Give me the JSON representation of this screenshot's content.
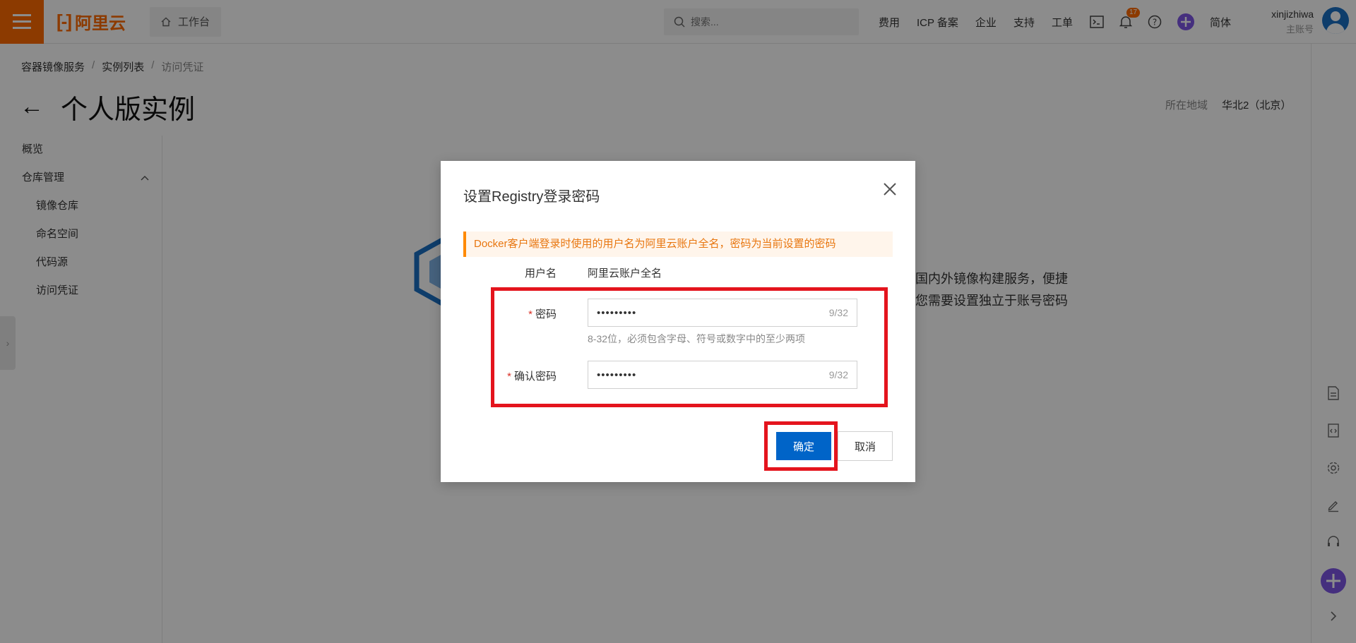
{
  "topbar": {
    "logo_text": "阿里云",
    "workbench_label": "工作台",
    "search_placeholder": "搜索...",
    "nav_links": [
      "费用",
      "ICP 备案",
      "企业",
      "支持",
      "工单"
    ],
    "notification_count": "17",
    "language": "简体",
    "username": "xinjizhiwa",
    "account_type": "主账号"
  },
  "breadcrumb": {
    "items": [
      "容器镜像服务",
      "实例列表",
      "访问凭证"
    ]
  },
  "page": {
    "title": "个人版实例",
    "region_label": "所在地域",
    "region_value": "华北2（北京）"
  },
  "sidebar": {
    "overview": "概览",
    "repo_group": "仓库管理",
    "sub_items": [
      "镜像仓库",
      "命名空间",
      "代码源",
      "访问凭证"
    ]
  },
  "background": {
    "line1": "国内外镜像构建服务，便捷",
    "line2": "您需要设置独立于账号密码"
  },
  "dialog": {
    "title": "设置Registry登录密码",
    "alert": "Docker客户端登录时使用的用户名为阿里云账户全名，密码为当前设置的密码",
    "username_label": "用户名",
    "username_value": "阿里云账户全名",
    "password_label": "密码",
    "password_value": "•••••••••",
    "password_count": "9/32",
    "password_hint": "8-32位，必须包含字母、符号或数字中的至少两项",
    "confirm_label": "确认密码",
    "confirm_value": "•••••••••",
    "confirm_count": "9/32",
    "ok_label": "确定",
    "cancel_label": "取消"
  },
  "colors": {
    "brand": "#ff6a00",
    "primary": "#0064c8",
    "highlight": "#e4141d",
    "alert_text": "#e8760f"
  }
}
